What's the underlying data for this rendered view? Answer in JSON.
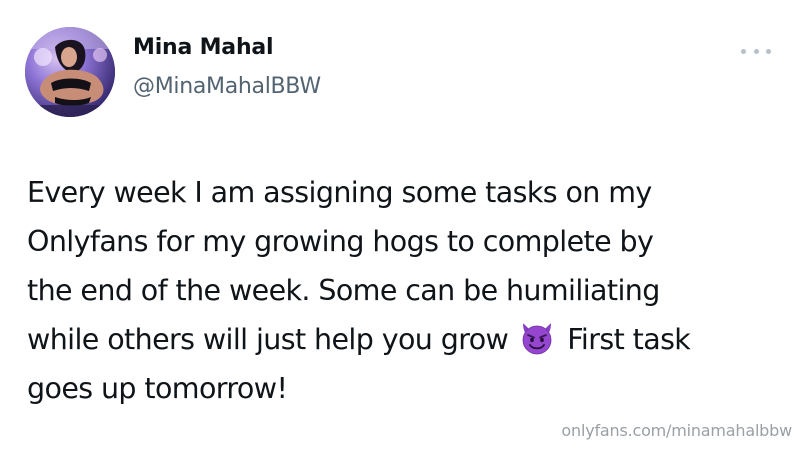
{
  "author": {
    "name": "Mina Mahal",
    "handle": "@MinaMahalBBW",
    "avatar_icon": "profile-photo"
  },
  "more_icon": "ellipsis-icon",
  "tweet": {
    "lines": [
      "Every week I am assigning some tasks on my",
      "Onlyfans for my growing hogs to complete by",
      "the end of the week. Some can be humiliating"
    ],
    "line4_before_emoji": "while others will just help you grow",
    "emoji": "smiling-face-with-horns",
    "line4_after_emoji": "First task",
    "line5": "goes up tomorrow!"
  },
  "watermark": "onlyfans.com/minamahalbbw",
  "colors": {
    "text": "#0f1419",
    "handle": "#536471",
    "emoji_purple": "#8a3fc7"
  }
}
